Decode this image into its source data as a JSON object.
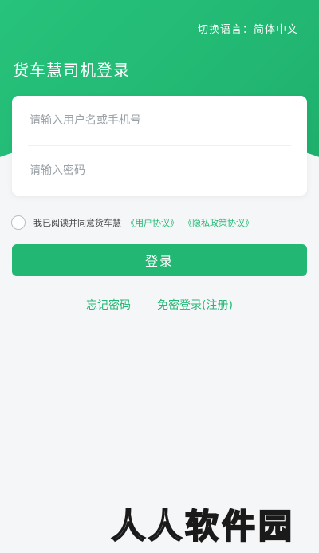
{
  "header": {
    "language_switch": "切换语言：简体中文",
    "title": "货车慧司机登录"
  },
  "form": {
    "username_placeholder": "请输入用户名或手机号",
    "password_placeholder": "请输入密码"
  },
  "agreement": {
    "text": "我已阅读并同意货车慧",
    "user_agreement": "《用户协议》",
    "privacy_policy": "《隐私政策协议》"
  },
  "actions": {
    "login_label": "登录",
    "forgot_password": "忘记密码",
    "password_free_login": "免密登录(注册)"
  },
  "watermark": {
    "text": "人人软件园"
  },
  "colors": {
    "accent": "#22b873",
    "background": "#f4f6f8"
  }
}
